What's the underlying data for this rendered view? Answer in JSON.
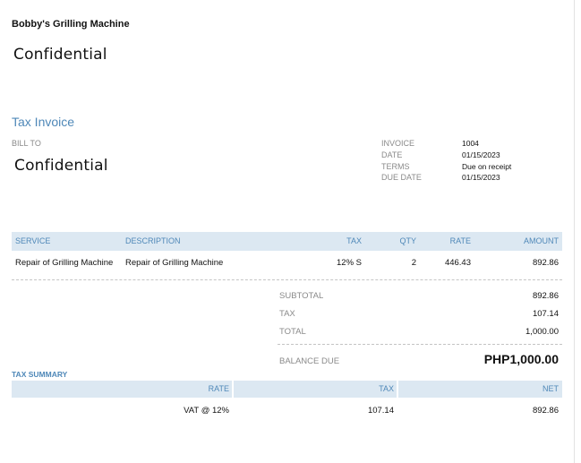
{
  "company_name": "Bobby's Grilling Machine",
  "confidential_top": "Confidential",
  "document_title": "Tax Invoice",
  "bill_to": {
    "label": "BILL TO",
    "name": "Confidential"
  },
  "invoice_meta": {
    "invoice_label": "INVOICE",
    "invoice_value": "1004",
    "date_label": "DATE",
    "date_value": "01/15/2023",
    "terms_label": "TERMS",
    "terms_value": "Due on receipt",
    "due_date_label": "DUE DATE",
    "due_date_value": "01/15/2023"
  },
  "items_table": {
    "headers": {
      "service": "SERVICE",
      "description": "DESCRIPTION",
      "tax": "TAX",
      "qty": "QTY",
      "rate": "RATE",
      "amount": "AMOUNT"
    },
    "rows": [
      {
        "service": "Repair of Grilling Machine",
        "description": "Repair of Grilling Machine",
        "tax": "12% S",
        "qty": "2",
        "rate": "446.43",
        "amount": "892.86"
      }
    ]
  },
  "totals": {
    "subtotal_label": "SUBTOTAL",
    "subtotal_value": "892.86",
    "tax_label": "TAX",
    "tax_value": "107.14",
    "total_label": "TOTAL",
    "total_value": "1,000.00",
    "balance_due_label": "BALANCE DUE",
    "balance_due_value": "PHP1,000.00"
  },
  "tax_summary": {
    "title": "TAX SUMMARY",
    "headers": {
      "rate": "RATE",
      "tax": "TAX",
      "net": "NET"
    },
    "rows": [
      {
        "rate": "VAT @ 12%",
        "tax": "107.14",
        "net": "892.86"
      }
    ]
  },
  "colors": {
    "accent": "#4f88b8",
    "header_fill": "#dce8f2",
    "muted_label": "#8a8a8a"
  }
}
